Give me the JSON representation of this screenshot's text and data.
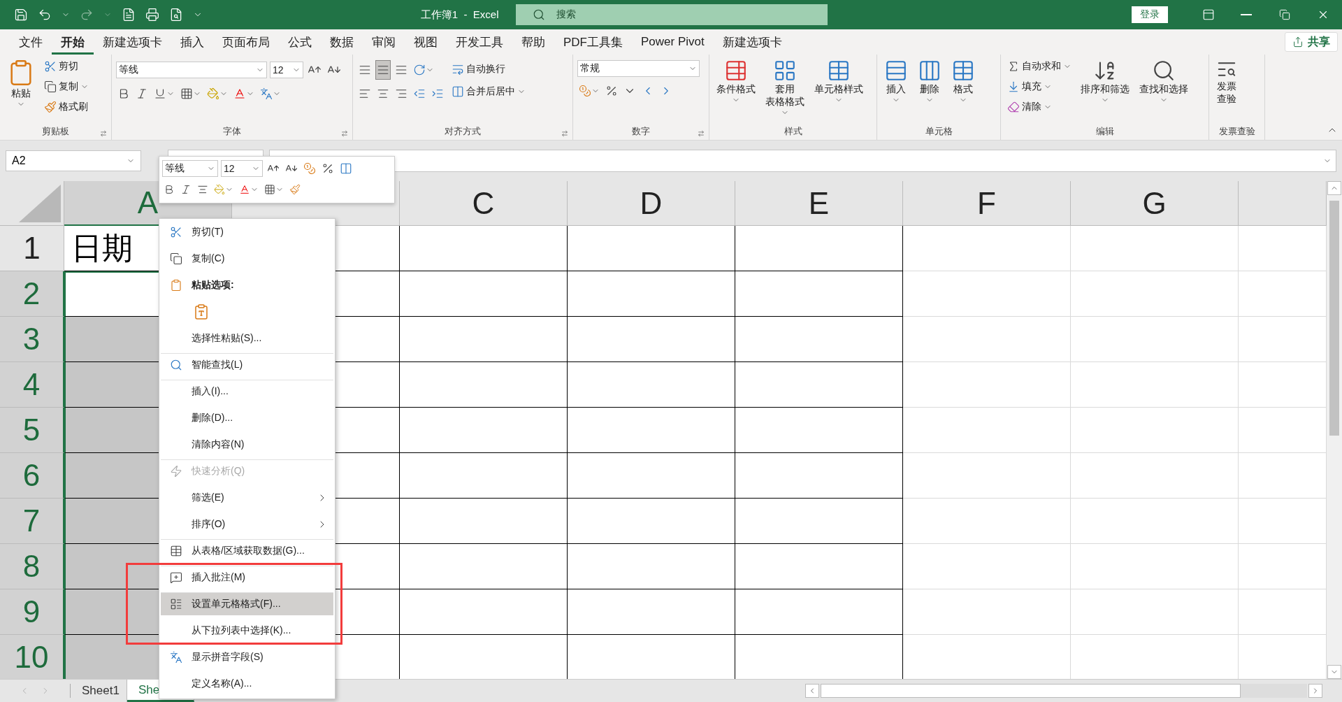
{
  "title_bar": {
    "title": "工作簿1  -  Excel",
    "search": {
      "placeholder": "搜索"
    },
    "login_button": "登录"
  },
  "menu_tabs": [
    {
      "label": "文件",
      "selected": false
    },
    {
      "label": "开始",
      "selected": true
    },
    {
      "label": "新建选项卡",
      "selected": false
    },
    {
      "label": "插入",
      "selected": false
    },
    {
      "label": "页面布局",
      "selected": false
    },
    {
      "label": "公式",
      "selected": false
    },
    {
      "label": "数据",
      "selected": false
    },
    {
      "label": "审阅",
      "selected": false
    },
    {
      "label": "视图",
      "selected": false
    },
    {
      "label": "开发工具",
      "selected": false
    },
    {
      "label": "帮助",
      "selected": false
    },
    {
      "label": "PDF工具集",
      "selected": false
    },
    {
      "label": "Power Pivot",
      "selected": false
    },
    {
      "label": "新建选项卡",
      "selected": false
    }
  ],
  "share_button": "共享",
  "ribbon": {
    "clipboard": {
      "label": "剪贴板",
      "paste": "粘贴",
      "cut": "剪切",
      "copy": "复制",
      "format_painter": "格式刷"
    },
    "font": {
      "label": "字体",
      "font_name": "等线",
      "font_size": "12"
    },
    "alignment": {
      "label": "对齐方式",
      "wrap_text": "自动换行",
      "merge_center": "合并后居中"
    },
    "number": {
      "label": "数字",
      "format": "常规"
    },
    "styles": {
      "label": "样式",
      "buttons": [
        {
          "lines": [
            "条件格式"
          ]
        },
        {
          "lines": [
            "套用",
            "表格格式"
          ]
        },
        {
          "lines": [
            "单元格样式"
          ]
        }
      ]
    },
    "cells": {
      "label": "单元格",
      "buttons": [
        "插入",
        "删除",
        "格式"
      ]
    },
    "editing": {
      "label": "编辑",
      "autosum": "自动求和",
      "fill": "填充",
      "clear": "清除",
      "sort_filter": "排序和筛选",
      "find_select": "查找和选择"
    },
    "invoice": {
      "label": "发票查验",
      "button": {
        "lines": [
          "发票",
          "查验"
        ]
      }
    }
  },
  "name_box": "A2",
  "mini_toolbar": {
    "font_name": "等线",
    "font_size": "12"
  },
  "sheet": {
    "columns": [
      {
        "label": "A",
        "selected": true
      },
      {
        "selected": false
      },
      {
        "label": "C",
        "selected": false
      },
      {
        "label": "D",
        "selected": false
      },
      {
        "label": "E",
        "selected": false
      },
      {
        "label": "F",
        "selected": false
      },
      {
        "label": "G",
        "selected": false
      },
      {
        "selected": false
      }
    ],
    "rows": [
      {
        "label": "1",
        "selected": false,
        "values": [
          "日期"
        ]
      },
      {
        "label": "2",
        "selected": true
      },
      {
        "label": "3",
        "selected": true
      },
      {
        "label": "4",
        "selected": true
      },
      {
        "label": "5",
        "selected": true
      },
      {
        "label": "6",
        "selected": true
      },
      {
        "label": "7",
        "selected": true
      },
      {
        "label": "8",
        "selected": true
      },
      {
        "label": "9",
        "selected": true
      },
      {
        "label": "10",
        "selected": true
      }
    ]
  },
  "context_menu": {
    "items": [
      {
        "kind": "command",
        "label": "剪切(T)",
        "disabled": false,
        "submenu": false,
        "highlighted": false,
        "divider_above": false
      },
      {
        "kind": "command",
        "label": "复制(C)",
        "disabled": false,
        "submenu": false,
        "highlighted": false,
        "divider_above": false
      },
      {
        "kind": "header",
        "label": "粘贴选项:"
      },
      {
        "kind": "paste_option"
      },
      {
        "kind": "command",
        "label": "选择性粘贴(S)...",
        "disabled": false,
        "submenu": false,
        "highlighted": false,
        "divider_above": false
      },
      {
        "kind": "command",
        "label": "智能查找(L)",
        "disabled": false,
        "submenu": false,
        "highlighted": false,
        "divider_above": true
      },
      {
        "kind": "command",
        "label": "插入(I)...",
        "disabled": false,
        "submenu": false,
        "highlighted": false,
        "divider_above": true
      },
      {
        "kind": "command",
        "label": "删除(D)...",
        "disabled": false,
        "submenu": false,
        "highlighted": false,
        "divider_above": false
      },
      {
        "kind": "command",
        "label": "清除内容(N)",
        "disabled": false,
        "submenu": false,
        "highlighted": false,
        "divider_above": false
      },
      {
        "kind": "command",
        "label": "快速分析(Q)",
        "disabled": true,
        "submenu": false,
        "highlighted": false,
        "divider_above": true
      },
      {
        "kind": "command",
        "label": "筛选(E)",
        "disabled": false,
        "submenu": true,
        "highlighted": false,
        "divider_above": false
      },
      {
        "kind": "command",
        "label": "排序(O)",
        "disabled": false,
        "submenu": true,
        "highlighted": false,
        "divider_above": false
      },
      {
        "kind": "command",
        "label": "从表格/区域获取数据(G)...",
        "disabled": false,
        "submenu": false,
        "highlighted": false,
        "divider_above": true
      },
      {
        "kind": "command",
        "label": "插入批注(M)",
        "disabled": false,
        "submenu": false,
        "highlighted": false,
        "divider_above": true
      },
      {
        "kind": "command",
        "label": "设置单元格格式(F)...",
        "disabled": false,
        "submenu": false,
        "highlighted": true,
        "divider_above": true
      },
      {
        "kind": "command",
        "label": "从下拉列表中选择(K)...",
        "disabled": false,
        "submenu": false,
        "highlighted": false,
        "divider_above": false
      },
      {
        "kind": "command",
        "label": "显示拼音字段(S)",
        "disabled": false,
        "submenu": false,
        "highlighted": false,
        "divider_above": false
      },
      {
        "kind": "command",
        "label": "定义名称(A)...",
        "disabled": false,
        "submenu": false,
        "highlighted": false,
        "divider_above": false
      }
    ]
  },
  "sheet_tabs": [
    {
      "label": "Sheet1",
      "selected": false
    },
    {
      "label": "She",
      "selected": true
    }
  ]
}
